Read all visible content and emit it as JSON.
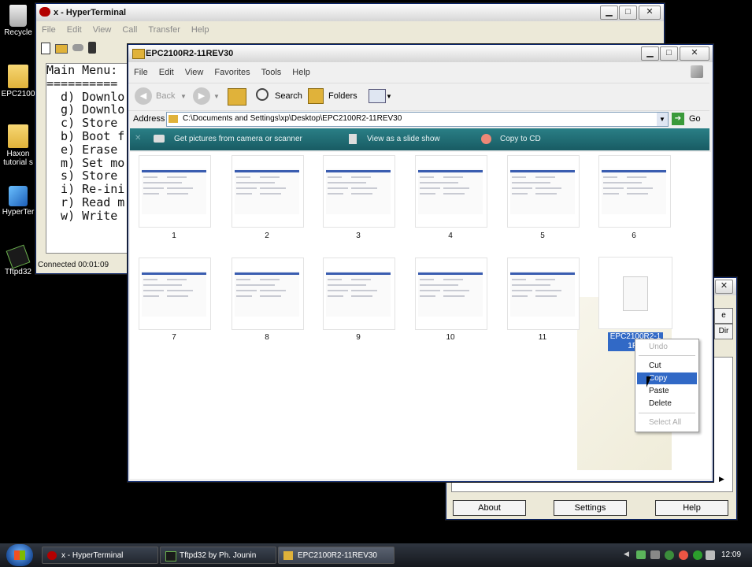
{
  "desktop": {
    "icons": [
      {
        "label": "Recycle"
      },
      {
        "label": "EPC2100"
      },
      {
        "label": "Haxon"
      },
      {
        "label": "tutorial s"
      },
      {
        "label": "HyperTer"
      },
      {
        "label": "Tftpd32"
      }
    ]
  },
  "hyperterminal": {
    "title": "x - HyperTerminal",
    "menu": [
      "File",
      "Edit",
      "View",
      "Call",
      "Transfer",
      "Help"
    ],
    "terminal_lines": [
      "Main Menu:",
      "==========",
      "  d) Downlo",
      "  g) Downlo",
      "  c) Store",
      "  b) Boot f",
      "  e) Erase",
      "  m) Set mo",
      "  s) Store",
      "  i) Re-ini",
      "  r) Read m",
      "  w) Write"
    ],
    "status": "Connected 00:01:09"
  },
  "explorer": {
    "title": "EPC2100R2-11REV30",
    "menu": [
      "File",
      "Edit",
      "View",
      "Favorites",
      "Tools",
      "Help"
    ],
    "toolbar": {
      "back": "Back",
      "search": "Search",
      "folders": "Folders"
    },
    "address_label": "Address",
    "address_value": "C:\\Documents and Settings\\xp\\Desktop\\EPC2100R2-11REV30",
    "go_label": "Go",
    "tasks": [
      "Get pictures from camera or scanner",
      "View as a slide show",
      "Copy to CD"
    ],
    "thumbnails": [
      "1",
      "2",
      "3",
      "4",
      "5",
      "6",
      "7",
      "8",
      "9",
      "10",
      "11"
    ],
    "selected_file_label_line1": "EPC2100R2-1",
    "selected_file_label_line2": "1RE"
  },
  "context_menu": {
    "undo": "Undo",
    "cut": "Cut",
    "copy": "Copy",
    "paste": "Paste",
    "delete": "Delete",
    "select_all": "Select All"
  },
  "tftpd": {
    "buttons": {
      "about": "About",
      "settings": "Settings",
      "help": "Help"
    },
    "partial_side_labels": [
      "e",
      "Dir"
    ]
  },
  "taskbar": {
    "items": [
      {
        "label": "x - HyperTerminal"
      },
      {
        "label": "Tftpd32 by Ph. Jounin"
      },
      {
        "label": "EPC2100R2-11REV30"
      }
    ],
    "clock": "12:09"
  },
  "colors": {
    "task_pane": "#1f6b75",
    "selection": "#3169c6",
    "xp_title_gradient": "#d6d6d6"
  }
}
